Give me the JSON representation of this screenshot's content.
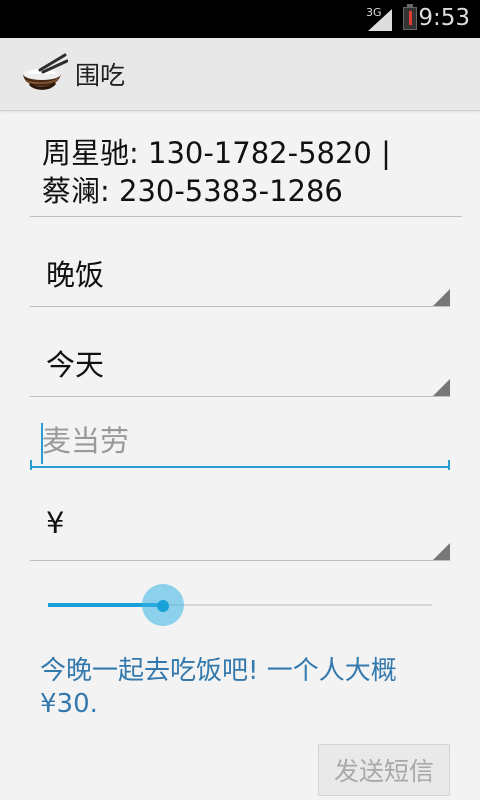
{
  "status_bar": {
    "network": "3G",
    "time": "9:53"
  },
  "app": {
    "title": "围吃",
    "icon": "rice-bowl-icon"
  },
  "form": {
    "contacts_line_1": "周星驰: 130-1782-5820 |",
    "contacts_line_2": "蔡澜: 230-5383-1286",
    "meal": "晚饭",
    "day": "今天",
    "place_placeholder": "麦当劳",
    "currency": "¥",
    "slider_value_fraction": 0.3,
    "message": "今晚一起去吃饭吧!  一个人大概 ¥30.",
    "send_label": "发送短信"
  },
  "colors": {
    "accent": "#1aa2d8",
    "message": "#3479ad"
  }
}
